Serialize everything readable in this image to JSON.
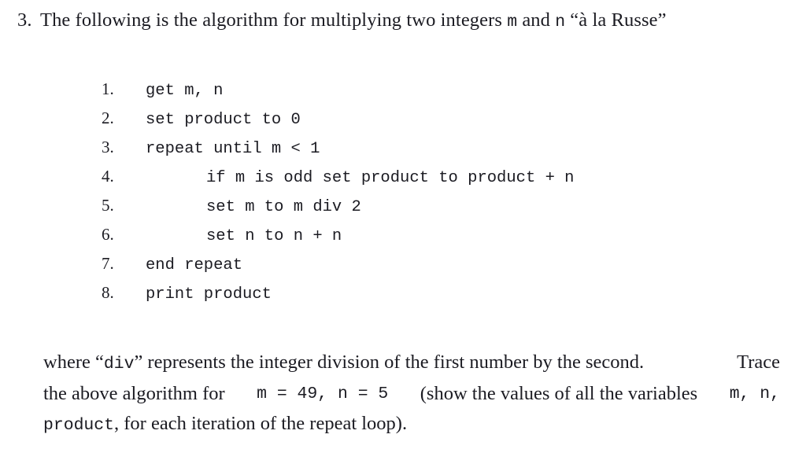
{
  "document": {
    "type": "textbook-exercise",
    "question_number": "3.",
    "heading": {
      "before_m": "The following is the algorithm for multiplying two integers ",
      "var_m": "m",
      "between": " and ",
      "var_n": "n",
      "after_n": " “à la Russe”"
    }
  },
  "algorithm": {
    "lines": [
      {
        "number": "1.",
        "code": "get m, n",
        "indented": false
      },
      {
        "number": "2.",
        "code": "set product to 0",
        "indented": false
      },
      {
        "number": "3.",
        "code": "repeat until m < 1",
        "indented": false
      },
      {
        "number": "4.",
        "code": "if m is odd set product to product + n",
        "indented": true
      },
      {
        "number": "5.",
        "code": "set m to m div 2",
        "indented": true
      },
      {
        "number": "6.",
        "code": "set n to n + n",
        "indented": true
      },
      {
        "number": "7.",
        "code": "end repeat",
        "indented": false
      },
      {
        "number": "8.",
        "code": "print product",
        "indented": false
      }
    ]
  },
  "trace_instructions": {
    "line1": {
      "seg_a": "where “",
      "mono_div": "div",
      "seg_b": "” represents the integer division of the first number by the second.",
      "seg_c": "Trace"
    },
    "line2": {
      "seg_a": "the above algorithm for",
      "mono_values": "m = 49, n = 5",
      "seg_b": "(show the values of all the variables",
      "mono_vars": "m, n,"
    },
    "line3": {
      "mono_product": "product",
      "seg_a": ", for each iteration of the repeat loop)."
    }
  },
  "variables": {
    "m_initial": 49,
    "n_initial": 5,
    "product_initial": 0
  },
  "colors": {
    "background": "#ffffff",
    "text": "#1b1b22"
  }
}
